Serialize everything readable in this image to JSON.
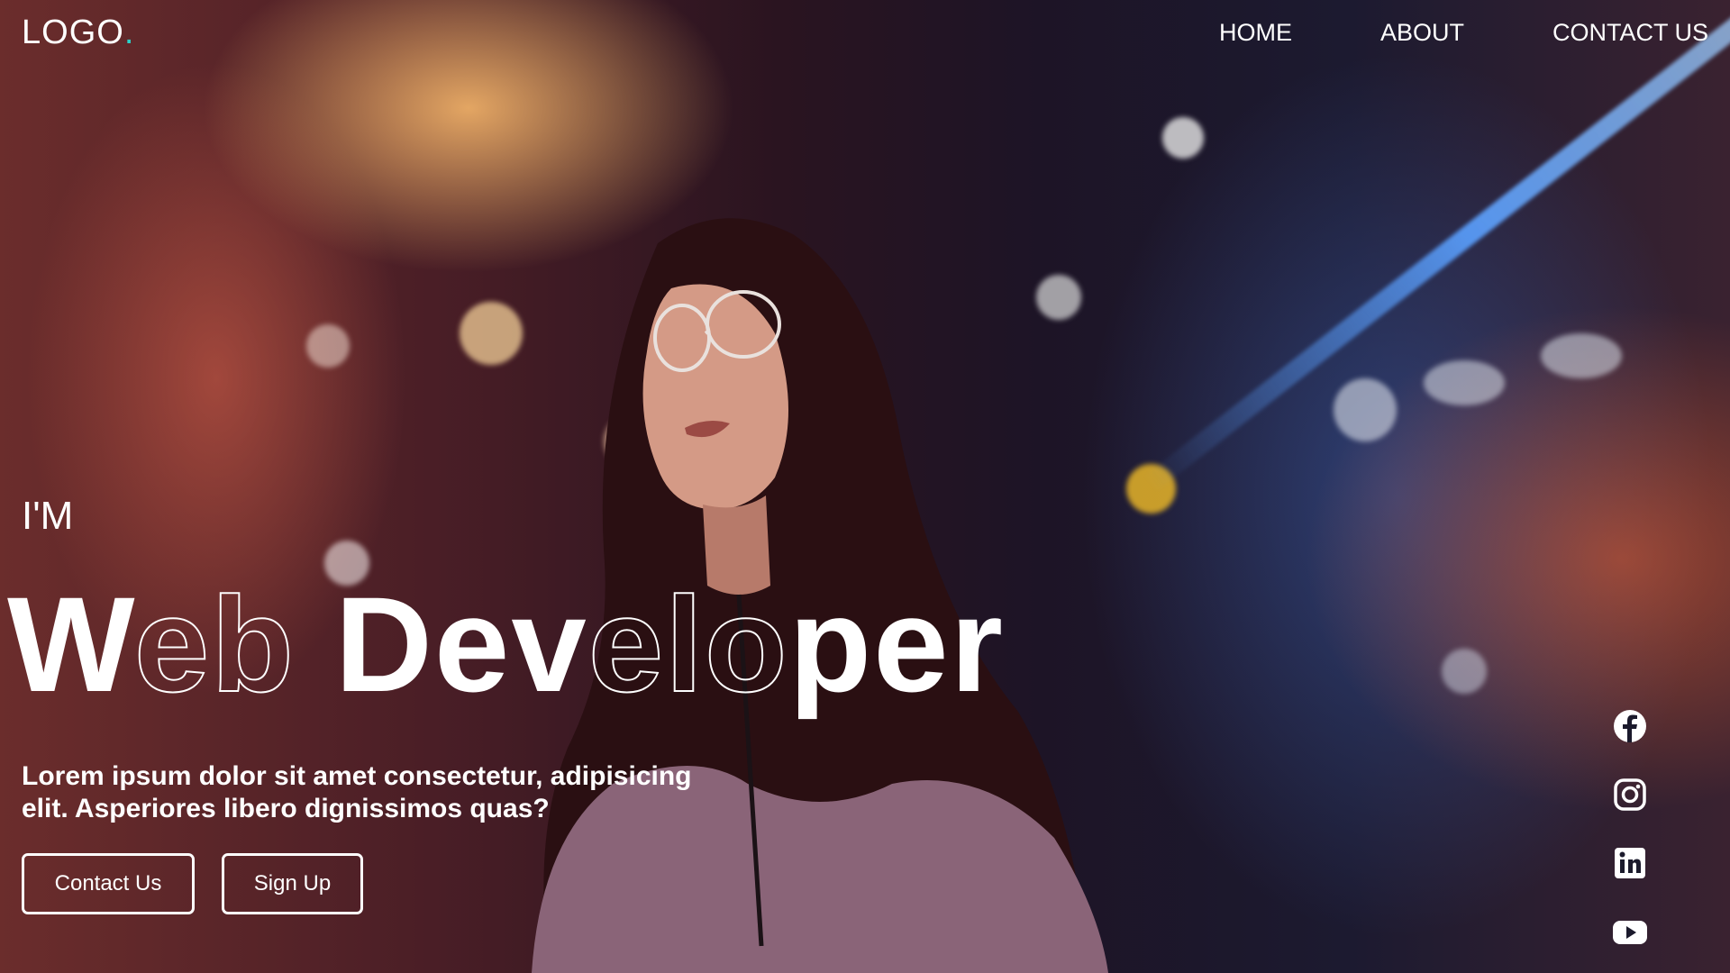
{
  "header": {
    "logo": "LOGO",
    "logo_dot": ".",
    "nav": [
      {
        "label": "HOME"
      },
      {
        "label": "ABOUT"
      },
      {
        "label": "CONTACT US"
      }
    ]
  },
  "hero": {
    "intro": "I'M",
    "headline": {
      "part1_solid": "W",
      "part1_outline": "eb",
      "part2_solid": "Dev",
      "part2_outline": "elo",
      "part3_solid": "per"
    },
    "description": "Lorem ipsum dolor sit amet consectetur, adipisicing elit. Asperiores libero dignissimos quas?",
    "buttons": {
      "contact": "Contact Us",
      "signup": "Sign Up"
    }
  },
  "social": [
    {
      "icon": "facebook-icon"
    },
    {
      "icon": "instagram-icon"
    },
    {
      "icon": "linkedin-icon"
    },
    {
      "icon": "youtube-icon"
    }
  ],
  "colors": {
    "accent": "#2ad1c9",
    "text": "#ffffff"
  }
}
